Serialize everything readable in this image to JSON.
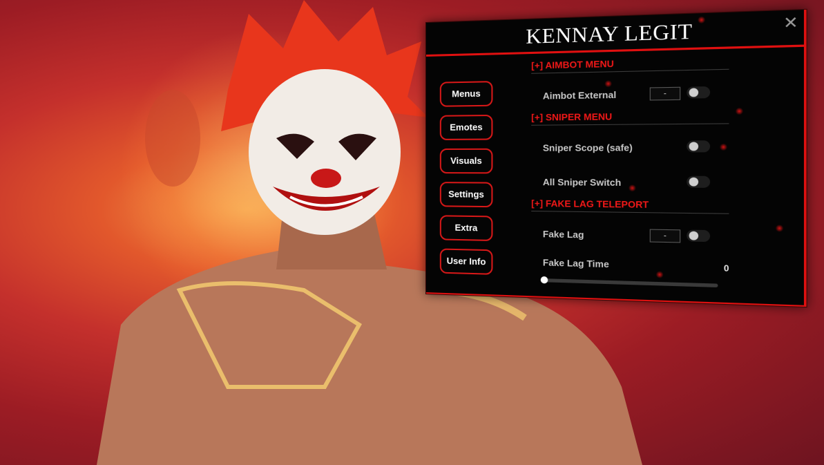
{
  "panel": {
    "title": "KENNAY LEGIT",
    "close_label": "✕",
    "accent_color": "#e01010"
  },
  "nav": {
    "items": [
      {
        "label": "Menus"
      },
      {
        "label": "Emotes"
      },
      {
        "label": "Visuals"
      },
      {
        "label": "Settings"
      },
      {
        "label": "Extra"
      },
      {
        "label": "User Info"
      }
    ]
  },
  "sections": {
    "aimbot": {
      "title": "[+] AIMBOT MENU",
      "aimbot_external": {
        "label": "Aimbot External",
        "key": "-",
        "enabled": false
      }
    },
    "sniper": {
      "title": "[+] SNIPER MENU",
      "sniper_scope": {
        "label": "Sniper Scope (safe)",
        "enabled": false
      },
      "all_sniper_switch": {
        "label": "All Sniper Switch",
        "enabled": false
      }
    },
    "fake_lag": {
      "title": "[+] FAKE LAG TELEPORT",
      "fake_lag": {
        "label": "Fake Lag",
        "key": "-",
        "enabled": false
      },
      "fake_lag_time": {
        "label": "Fake Lag Time",
        "value": "0",
        "fraction": 0.0
      }
    }
  }
}
